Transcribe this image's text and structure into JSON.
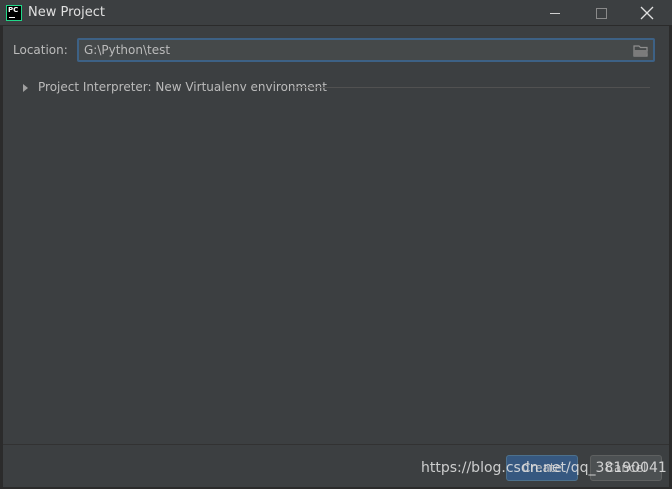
{
  "window": {
    "app_icon_text": "PC",
    "title": "New Project",
    "controls": [
      "minimize-icon",
      "maximize-icon",
      "close-icon"
    ]
  },
  "location": {
    "label": "Location:",
    "value": "G:\\Python\\test",
    "browse_icon": "folder-icon"
  },
  "interpreter": {
    "label": "Project Interpreter: New Virtualenv environment",
    "expanded": false
  },
  "buttons": {
    "create": "Create",
    "cancel": "Cancel"
  },
  "watermark": "https://blog.csdn.net/qq_38190041",
  "colors": {
    "background": "#3c3f41",
    "field_background": "#45494a",
    "focus_border": "#3d6185",
    "primary_button": "#365880",
    "text": "#bbbbbb"
  }
}
